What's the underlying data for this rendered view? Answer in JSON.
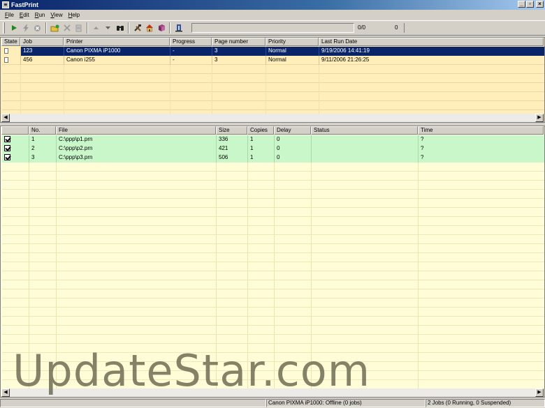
{
  "window": {
    "title": "FastPrint",
    "minimize": "_",
    "maximize": "▫",
    "close": "×"
  },
  "menu": [
    {
      "key": "F",
      "rest": "ile"
    },
    {
      "key": "E",
      "rest": "dit"
    },
    {
      "key": "R",
      "rest": "un"
    },
    {
      "key": "V",
      "rest": "iew"
    },
    {
      "key": "H",
      "rest": "elp"
    }
  ],
  "toolbar": {
    "counter_progress": "0/0",
    "counter_count": "0"
  },
  "jobs": {
    "columns": [
      "State",
      "Job",
      "Printer",
      "Progress",
      "Page number",
      "Priority",
      "Last Run Date"
    ],
    "rows": [
      {
        "job": "123",
        "printer": "Canon PIXMA iP1000",
        "progress": "-",
        "pages": "3",
        "priority": "Normal",
        "date": "9/19/2006 14:41:19"
      },
      {
        "job": "456",
        "printer": "Canon i255",
        "progress": "-",
        "pages": "3",
        "priority": "Normal",
        "date": "9/11/2006 21:26:25"
      }
    ]
  },
  "files": {
    "columns": [
      "",
      "No.",
      "File",
      "Size",
      "Copies",
      "Delay",
      "Status",
      "Time"
    ],
    "rows": [
      {
        "no": "1",
        "file": "C:\\ppp\\p1.prn",
        "size": "336",
        "copies": "1",
        "delay": "0",
        "status": "",
        "time": "?"
      },
      {
        "no": "2",
        "file": "C:\\ppp\\p2.prn",
        "size": "421",
        "copies": "1",
        "delay": "0",
        "status": "",
        "time": "?"
      },
      {
        "no": "3",
        "file": "C:\\ppp\\p3.prn",
        "size": "506",
        "copies": "1",
        "delay": "0",
        "status": "",
        "time": "?"
      }
    ]
  },
  "watermark": "UpdateStar.com",
  "status": {
    "printer": "Canon PIXMA iP1000: Offline (0 jobs)",
    "jobs": "2 Jobs (0 Running, 0 Suspended)"
  }
}
